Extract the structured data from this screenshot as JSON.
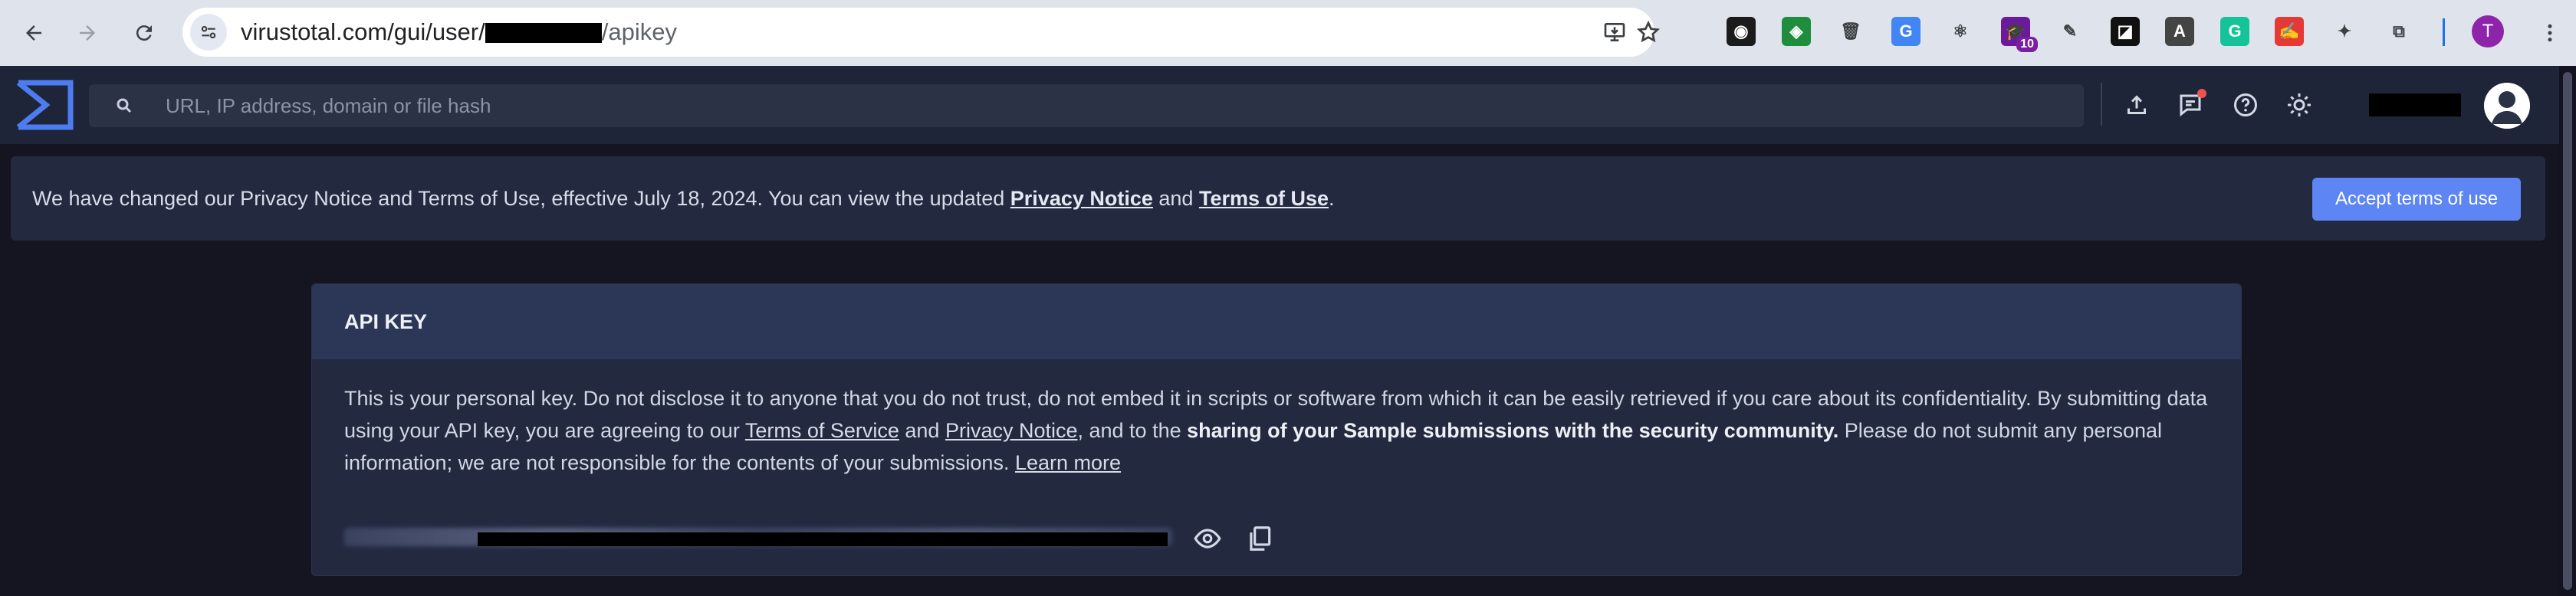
{
  "browser": {
    "url_prefix": "virustotal.com/gui/user/",
    "url_suffix": "/apikey",
    "extension_badge": "10",
    "profile_initial": "T",
    "extensions": [
      {
        "name": "color-picker-extension-icon",
        "bg": "#1b1b1b",
        "glyph": "◉"
      },
      {
        "name": "shield-extension-icon",
        "bg": "#1e8e3e",
        "glyph": "◈"
      },
      {
        "name": "trash-extension-icon",
        "bg": "#dfe3ec",
        "glyph": "🗑"
      },
      {
        "name": "translate-extension-icon",
        "bg": "#4285f4",
        "glyph": "G"
      },
      {
        "name": "react-extension-icon",
        "bg": "#dfe3ec",
        "glyph": "⚛"
      },
      {
        "name": "graduation-cap-extension-icon",
        "bg": "#6a1b9a",
        "glyph": "🎓"
      },
      {
        "name": "edit-extension-icon",
        "bg": "#dfe3ec",
        "glyph": "✎"
      },
      {
        "name": "notion-extension-icon",
        "bg": "#111111",
        "glyph": "◪"
      },
      {
        "name": "font-extension-icon",
        "bg": "#444444",
        "glyph": "A"
      },
      {
        "name": "grammarly-extension-icon",
        "bg": "#15c39a",
        "glyph": "G"
      },
      {
        "name": "pdf-extension-icon",
        "bg": "#e53935",
        "glyph": "✍"
      },
      {
        "name": "puzzle-extensions-icon",
        "bg": "#dfe3ec",
        "glyph": "✦"
      },
      {
        "name": "side-panel-icon",
        "bg": "#dfe3ec",
        "glyph": "⧉"
      }
    ]
  },
  "header": {
    "search_placeholder": "URL, IP address, domain or file hash"
  },
  "banner": {
    "text_before": "We have changed our Privacy Notice and Terms of Use, effective July 18, 2024. You can view the updated ",
    "privacy_link": "Privacy Notice",
    "and": " and ",
    "terms_link": "Terms of Use",
    "period": ".",
    "accept_button": "Accept terms of use"
  },
  "card": {
    "title": "API KEY",
    "text_1": "This is your personal key. Do not disclose it to anyone that you do not trust, do not embed it in scripts or software from which it can be easily retrieved if you care about its confidentiality. By submitting data using your API key, you are agreeing to our ",
    "terms_of_service_link": "Terms of Service",
    "text_2": " and ",
    "privacy_notice_link": "Privacy Notice",
    "text_3": ", and to the ",
    "bold_text": "sharing of your Sample submissions with the security community.",
    "text_4": " Please do not submit any personal information; we are not responsible for the contents of your submissions. ",
    "learn_more_link": "Learn more"
  },
  "colors": {
    "accent": "#5d86f4",
    "page_bg": "#151522",
    "card_bg": "#232a40"
  }
}
